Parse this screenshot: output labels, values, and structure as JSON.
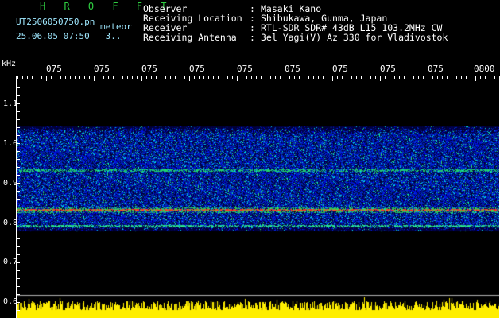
{
  "header": {
    "title": "H R O F F T",
    "filename": "UT2506050750.pn",
    "file_suffix": "meteor",
    "date_time": "25.06.05 07:50   3..",
    "fields": [
      {
        "label": "Observer",
        "value": "Masaki Kano"
      },
      {
        "label": "Receiving Location",
        "value": "Shibukawa, Gunma, Japan"
      },
      {
        "label": "Receiver",
        "value": "RTL-SDR SDR# 43dB L15 103.2MHz CW"
      },
      {
        "label": "Receiving Antenna",
        "value": "3el Yagi(V) Az 330 for Vladivostok"
      }
    ]
  },
  "axes": {
    "y_unit": "kHz",
    "y_labels": [
      "1.1",
      "1.0",
      "0.9",
      "0.8",
      "0.7",
      "0.6"
    ],
    "time_labels": [
      "075",
      "075",
      "075",
      "075",
      "075",
      "075",
      "075",
      "075",
      "075",
      "0800"
    ]
  },
  "spectrogram": {
    "freq_range_khz": [
      0.6,
      1.15
    ],
    "signal_band_khz": [
      0.79,
      1.04
    ],
    "bright_lines_khz": [
      0.835,
      0.94,
      0.79
    ],
    "colors": {
      "background": "#000000",
      "noise": "#0a2cc8",
      "line": "#ff3030",
      "meteor_amplitude": "#ffee00"
    }
  }
}
